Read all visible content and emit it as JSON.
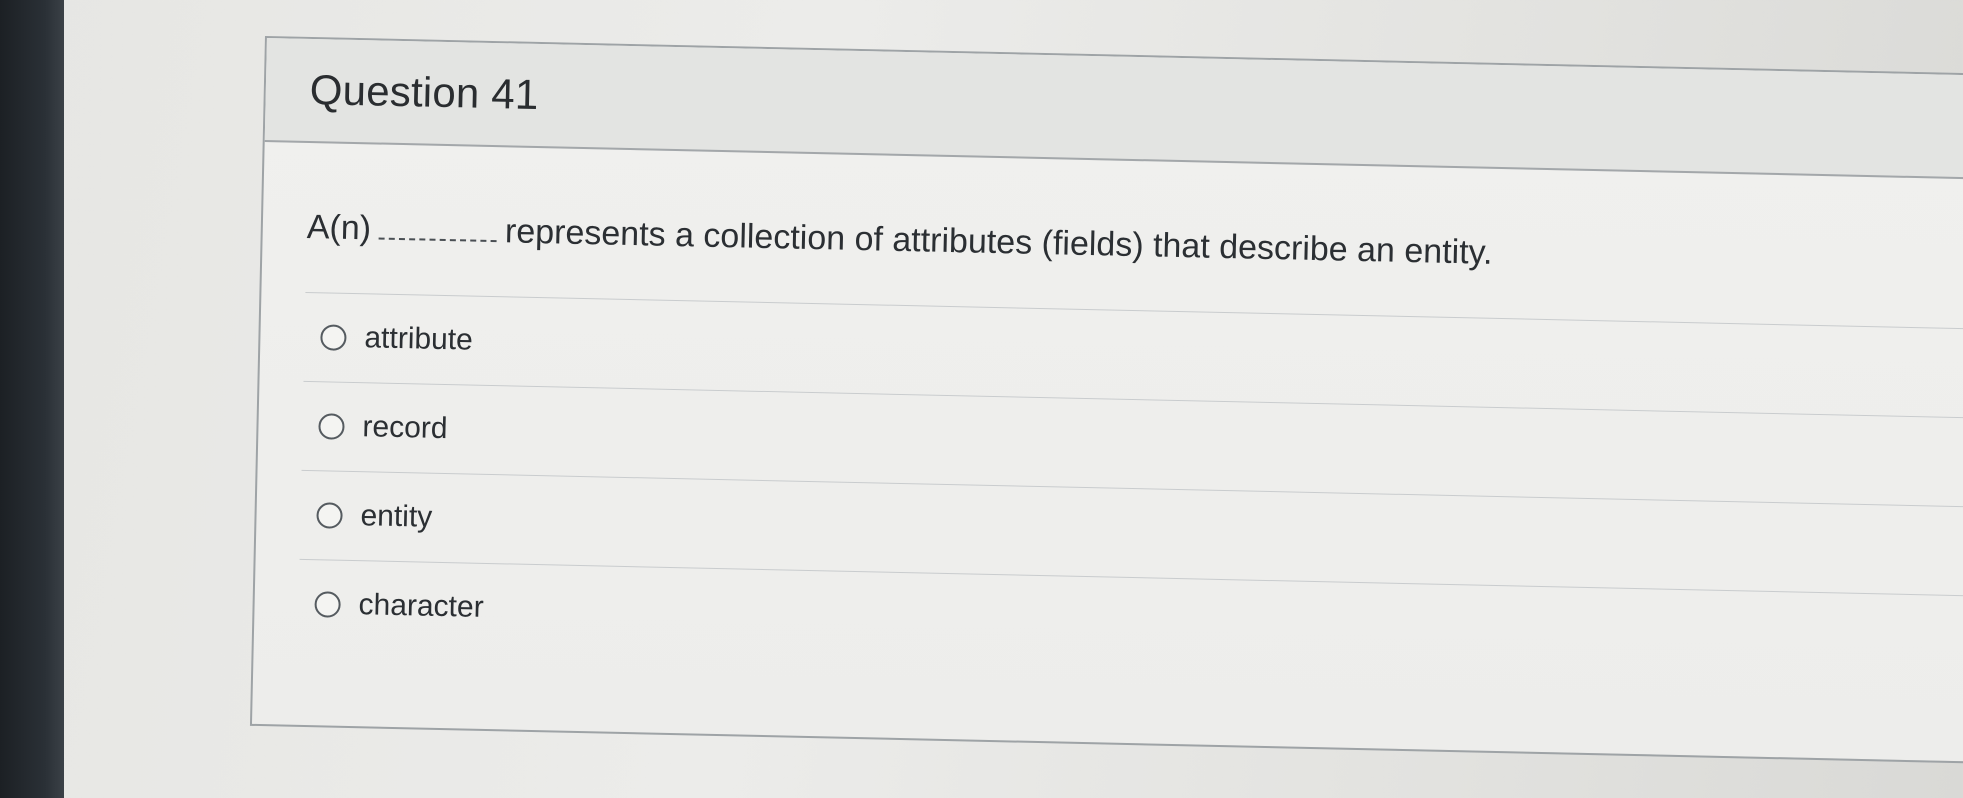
{
  "question": {
    "title": "Question 41",
    "text_before_blank": "A(n)",
    "text_after_blank": "represents a collection of attributes (fields) that describe an entity.",
    "answers": [
      {
        "label": "attribute",
        "selected": false
      },
      {
        "label": "record",
        "selected": false
      },
      {
        "label": "entity",
        "selected": false
      },
      {
        "label": "character",
        "selected": false
      }
    ]
  }
}
